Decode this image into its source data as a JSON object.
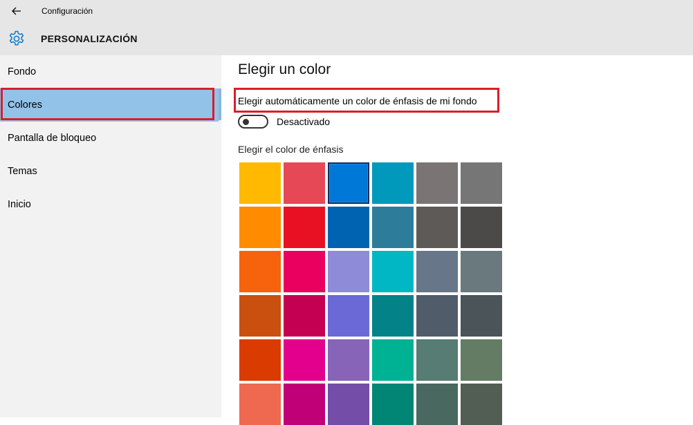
{
  "window": {
    "app_title": "Configuración",
    "section_title": "PERSONALIZACIÓN"
  },
  "sidebar": {
    "items": [
      {
        "label": "Fondo"
      },
      {
        "label": "Colores",
        "selected": true
      },
      {
        "label": "Pantalla de bloqueo"
      },
      {
        "label": "Temas"
      },
      {
        "label": "Inicio"
      }
    ]
  },
  "content": {
    "title": "Elegir un color",
    "auto_color_label": "Elegir automáticamente un color de énfasis de mi fondo",
    "toggle_state": "Desactivado",
    "toggle_on": false,
    "accent_label": "Elegir el color de énfasis",
    "selected_swatch": 2,
    "swatches": [
      "#ffb900",
      "#e74856",
      "#0078d7",
      "#0099bc",
      "#7a7574",
      "#767676",
      "#ff8c00",
      "#e81123",
      "#0063b1",
      "#2d7d9a",
      "#5d5a58",
      "#4c4a48",
      "#f7630c",
      "#ea005e",
      "#8e8cd8",
      "#00b7c3",
      "#68768a",
      "#69797e",
      "#ca5010",
      "#c30052",
      "#6b69d6",
      "#038387",
      "#515c6b",
      "#4a5459",
      "#da3b01",
      "#e3008c",
      "#8764b8",
      "#00b294",
      "#567c73",
      "#647c64",
      "#ef6950",
      "#bf0077",
      "#744da9",
      "#018574",
      "#486860",
      "#525e54"
    ]
  },
  "colors": {
    "highlight_red": "#d81e2a",
    "selected_nav": "#93c2e8",
    "accent_icon": "#0078d7"
  },
  "icons": {
    "back": "arrow-left-icon",
    "settings": "gear-icon"
  }
}
